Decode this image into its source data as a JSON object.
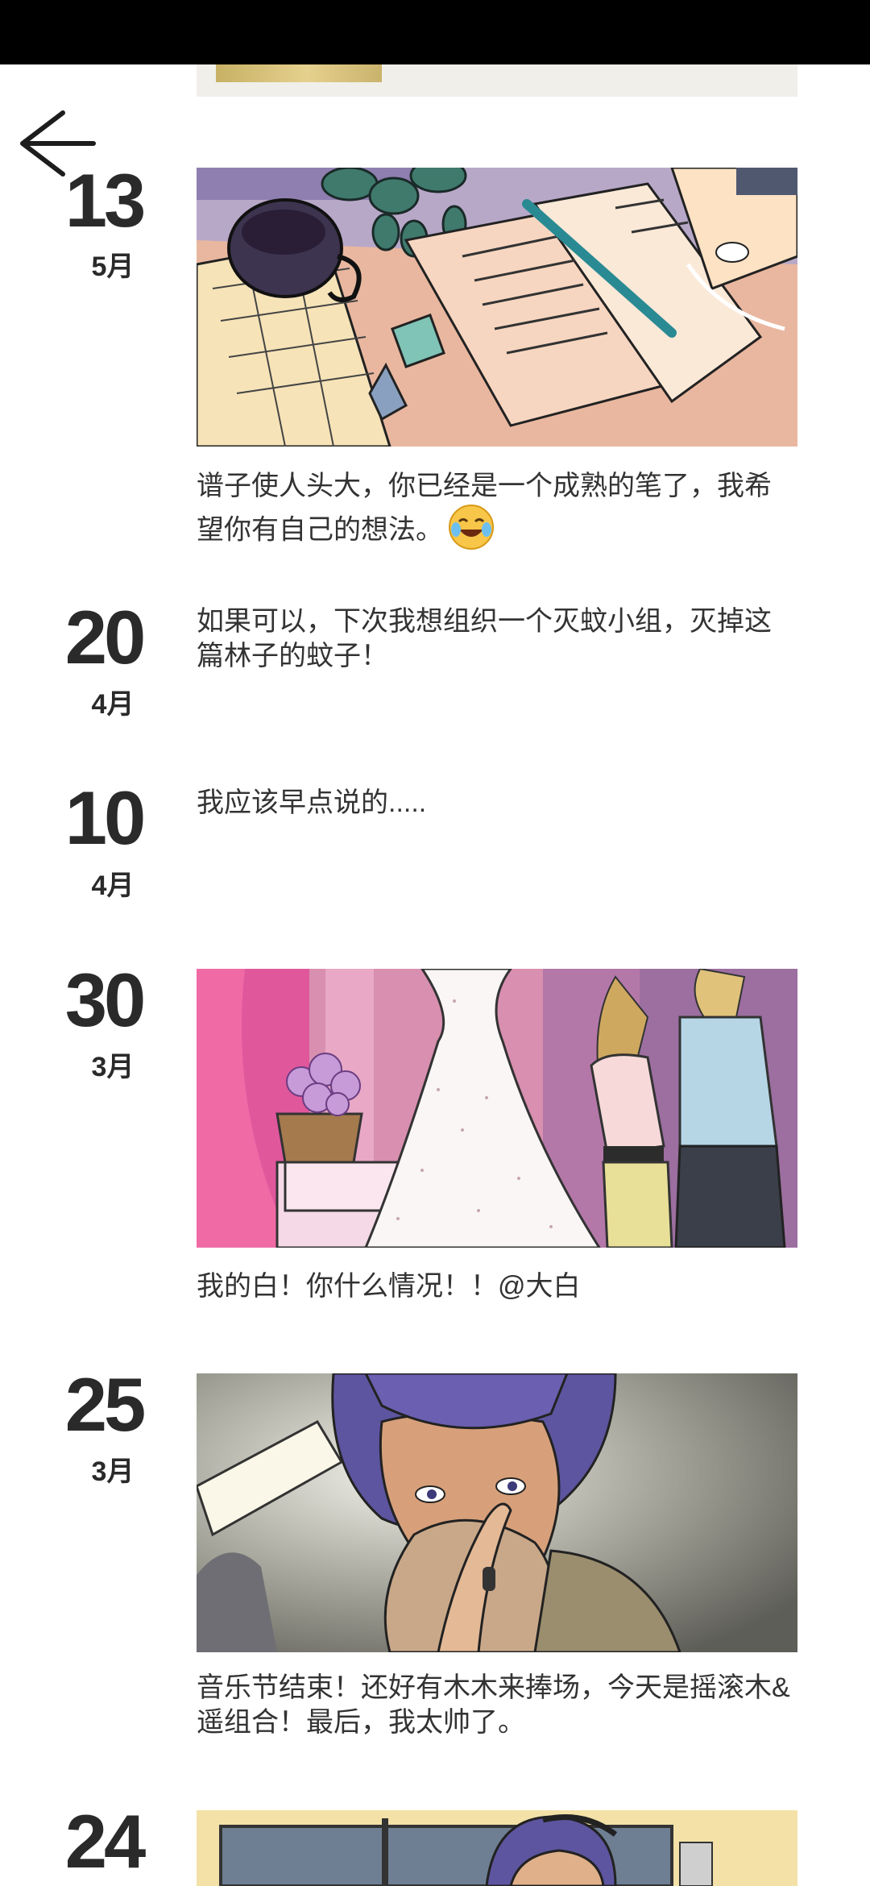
{
  "nav": {
    "back_icon": "arrow-left-icon"
  },
  "entries": [
    {
      "day": "13",
      "month": "5月",
      "caption": "谱子使人头大，你已经是一个成熟的笔了，我希望你有自己的想法。",
      "caption_emoji": "laughing-tears-emoji",
      "image": "desk-notebook-illustration"
    },
    {
      "day": "20",
      "month": "4月",
      "caption": "如果可以，下次我想组织一个灭蚊小组，灭掉这篇林子的蚊子！"
    },
    {
      "day": "10",
      "month": "4月",
      "caption": "我应该早点说的....."
    },
    {
      "day": "30",
      "month": "3月",
      "caption": "我的白！你什么情况！！@大白",
      "image": "wedding-dress-shop-illustration"
    },
    {
      "day": "25",
      "month": "3月",
      "caption": "音乐节结束！还好有木木来捧场，今天是摇滚木&遥组合！最后，我太帅了。",
      "image": "musician-portrait-illustration"
    },
    {
      "day": "24",
      "image": "room-headphones-illustration"
    }
  ],
  "colors": {
    "status_bar": "#000000",
    "text": "#2a2a2a",
    "background": "#ffffff"
  }
}
